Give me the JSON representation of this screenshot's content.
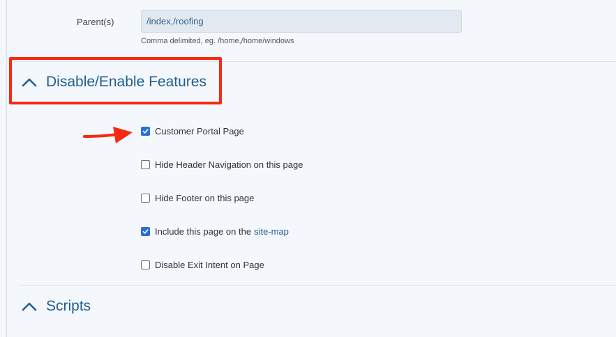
{
  "parents": {
    "label": "Parent(s)",
    "value": "/index,/roofing",
    "hint": "Comma delimited, eg. /home,/home/windows"
  },
  "features_section": {
    "title": "Disable/Enable Features",
    "options": [
      {
        "label": "Customer Portal Page",
        "checked": true
      },
      {
        "label": "Hide Header Navigation on this page",
        "checked": false
      },
      {
        "label": "Hide Footer on this page",
        "checked": false
      },
      {
        "label": "Include this page on the",
        "link": "site-map",
        "checked": true
      },
      {
        "label": "Disable Exit Intent on Page",
        "checked": false
      }
    ]
  },
  "scripts_section": {
    "title": "Scripts"
  },
  "colors": {
    "accent": "#1f5f94",
    "checkbox": "#2a6fd8",
    "annotation": "#f42a14"
  }
}
